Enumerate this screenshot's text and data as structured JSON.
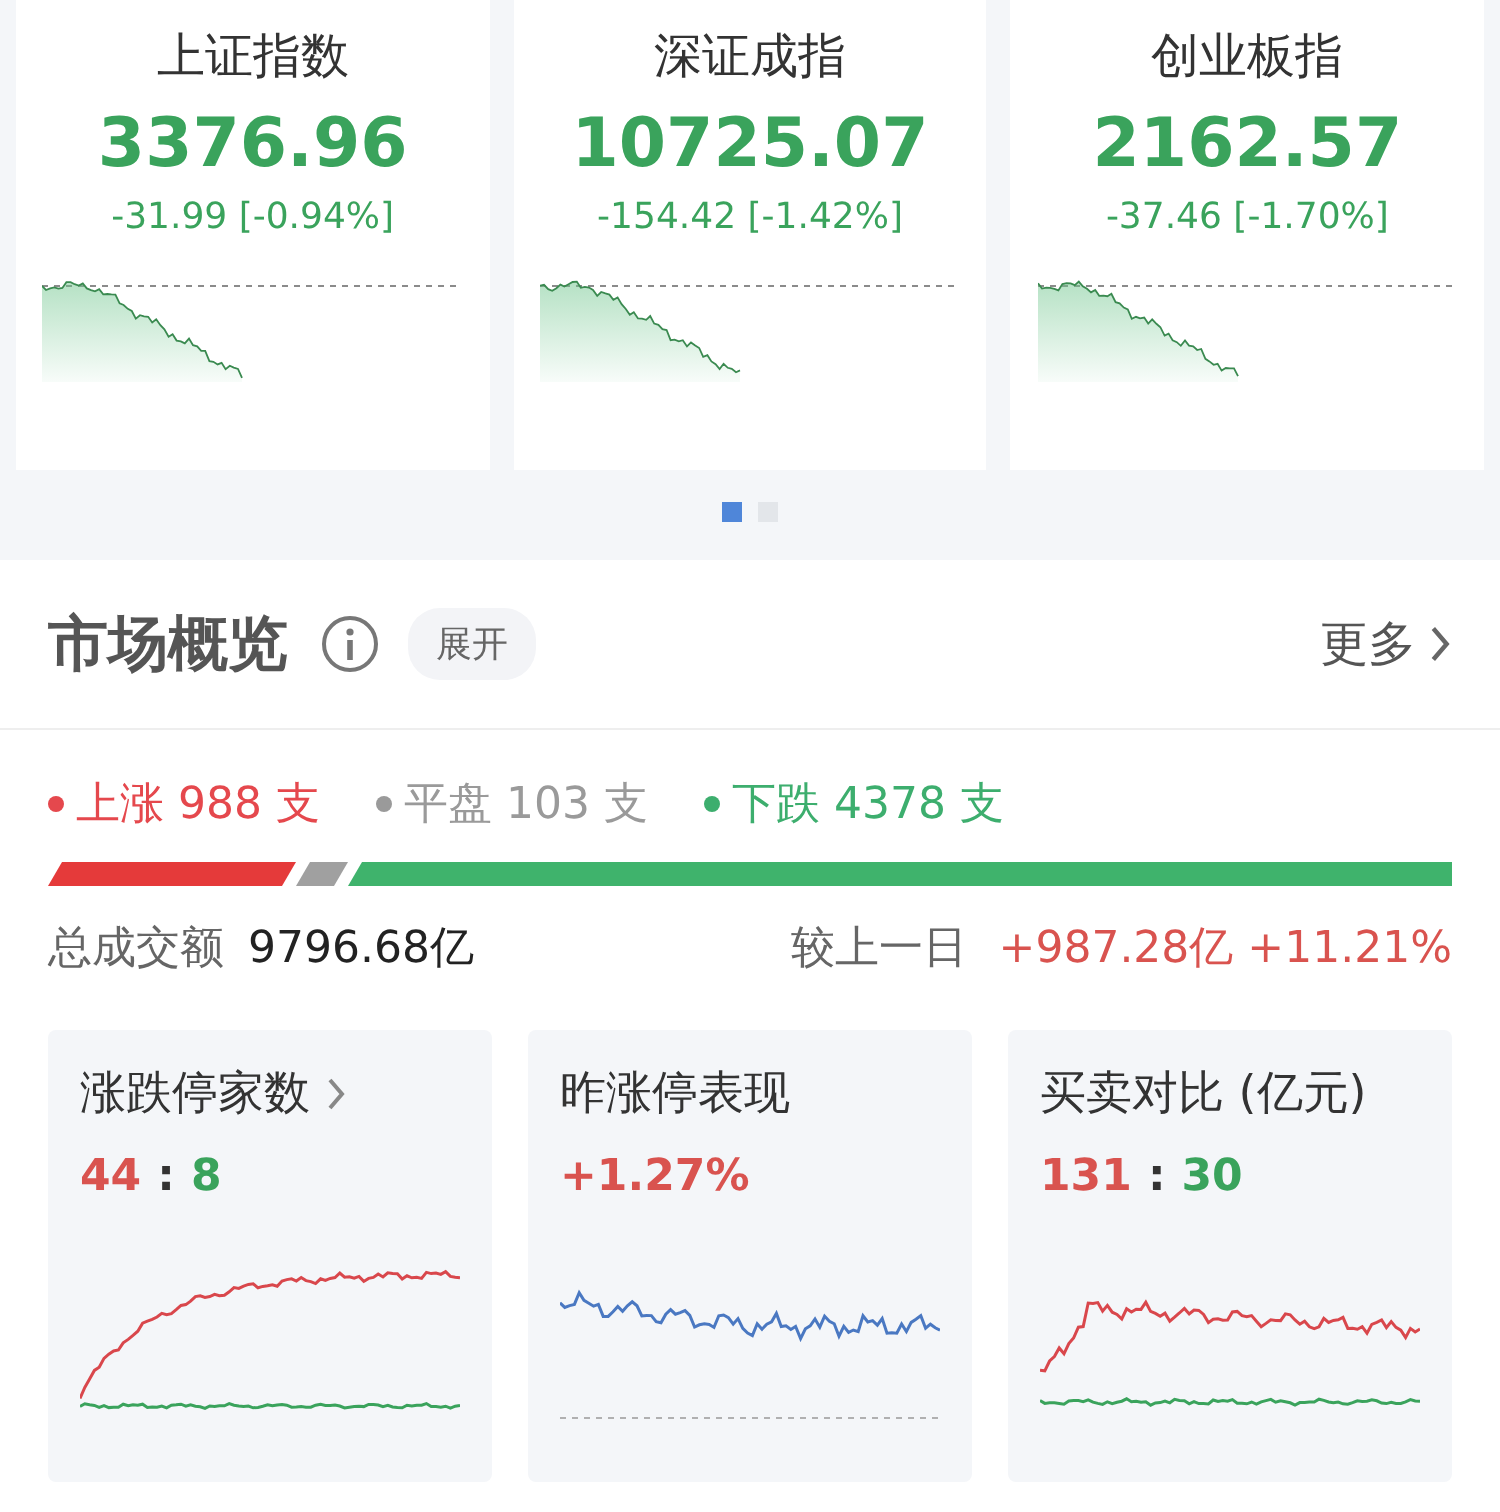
{
  "indices": [
    {
      "name": "上证指数",
      "value": "3376.96",
      "change": "-31.99 [-0.94%]"
    },
    {
      "name": "深证成指",
      "value": "10725.07",
      "change": "-154.42 [-1.42%]"
    },
    {
      "name": "创业板指",
      "value": "2162.57",
      "change": "-37.46 [-1.70%]"
    }
  ],
  "pages": [
    {
      "selected": true
    },
    {
      "selected": false
    }
  ],
  "overview": {
    "title": "市场概览",
    "toggle": "展开",
    "more": "更多",
    "breadth": [
      {
        "label": "上涨 988 支",
        "color": "#e5484d"
      },
      {
        "label": "平盘 103 支",
        "color": "#9a9a9a"
      },
      {
        "label": "下跌 4378 支",
        "color": "#3dae6e"
      }
    ],
    "turnover_label": "总成交额",
    "turnover": "9796.68亿",
    "compare_label": "较上一日",
    "compare": "+987.28亿 +11.21%"
  },
  "cards": [
    {
      "title": "涨跌停家数",
      "link": true,
      "kind": "updown",
      "figures": [
        {
          "text": "44",
          "kind": "up"
        },
        {
          "text": ":",
          "kind": "sep"
        },
        {
          "text": "8",
          "kind": "down"
        }
      ]
    },
    {
      "title": "昨涨停表现",
      "link": false,
      "kind": "single",
      "figures": [
        {
          "text": "+1.27%",
          "kind": "up"
        }
      ]
    },
    {
      "title": "买卖对比 (亿元)",
      "link": false,
      "kind": "buysell",
      "figures": [
        {
          "text": "131",
          "kind": "up"
        },
        {
          "text": ":",
          "kind": "sep"
        },
        {
          "text": "30",
          "kind": "down"
        }
      ]
    }
  ]
}
